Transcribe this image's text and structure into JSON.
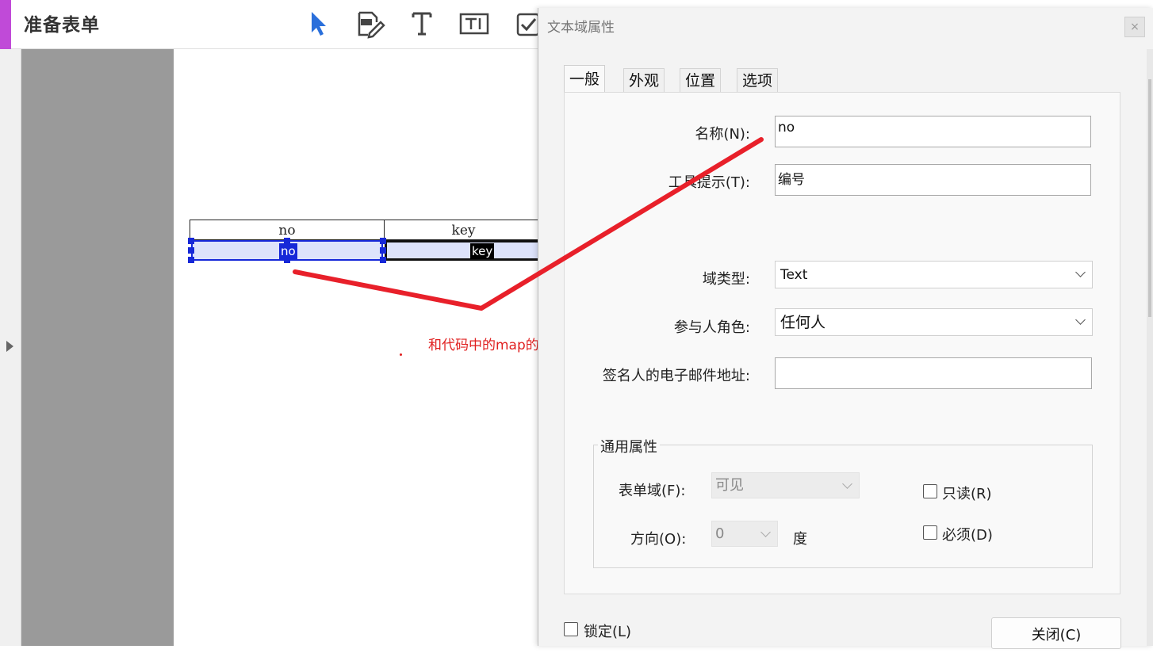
{
  "app": {
    "title": "准备表单"
  },
  "toolbar": {
    "tools": [
      "select-tool",
      "edit-form-tool",
      "text-tool",
      "textfield-tool",
      "checkbox-tool"
    ]
  },
  "form": {
    "header_no": "no",
    "header_key": "key",
    "field_no": "no",
    "field_key": "key"
  },
  "annotation": {
    "text": "和代码中的map的key值对应",
    "color": "#e02020"
  },
  "dialog": {
    "title": "文本域属性",
    "close_symbol": "×",
    "tabs": [
      "一般",
      "外观",
      "位置",
      "选项"
    ],
    "general": {
      "name_label": "名称(N):",
      "name_value": "no",
      "tooltip_label": "工具提示(T):",
      "tooltip_value": "编号",
      "field_type_label": "域类型:",
      "field_type_value": "Text",
      "role_label": "参与人角色:",
      "role_value": "任何人",
      "email_label": "签名人的电子邮件地址:",
      "email_value": ""
    },
    "common": {
      "title": "通用属性",
      "form_field_label": "表单域(F):",
      "form_field_value": "可见",
      "orientation_label": "方向(O):",
      "orientation_value": "0",
      "degree_label": "度",
      "readonly_label": "只读(R)",
      "required_label": "必须(D)"
    },
    "locked_label": "锁定(L)",
    "close_button": "关闭(C)"
  },
  "colors": {
    "accent": "#c04ad8",
    "selection": "#1628d8",
    "annotation": "#e02020",
    "icon_blue": "#2a6fdb"
  }
}
